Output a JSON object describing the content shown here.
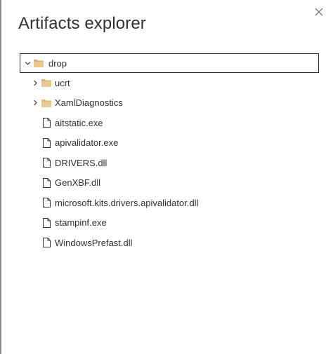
{
  "panel": {
    "title": "Artifacts explorer",
    "close_icon": "close-icon"
  },
  "tree": {
    "root": {
      "label": "drop",
      "expanded": true,
      "icon": "folder-icon",
      "children": [
        {
          "label": "ucrt",
          "type": "folder",
          "expanded": false
        },
        {
          "label": "XamlDiagnostics",
          "type": "folder",
          "expanded": false
        },
        {
          "label": "aitstatic.exe",
          "type": "file"
        },
        {
          "label": "apivalidator.exe",
          "type": "file"
        },
        {
          "label": "DRIVERS.dll",
          "type": "file"
        },
        {
          "label": "GenXBF.dll",
          "type": "file"
        },
        {
          "label": "microsoft.kits.drivers.apivalidator.dll",
          "type": "file"
        },
        {
          "label": "stampinf.exe",
          "type": "file"
        },
        {
          "label": "WindowsPrefast.dll",
          "type": "file"
        }
      ]
    }
  },
  "colors": {
    "folder": "#dcb67a",
    "text": "#323130",
    "selection_border": "#323130"
  }
}
